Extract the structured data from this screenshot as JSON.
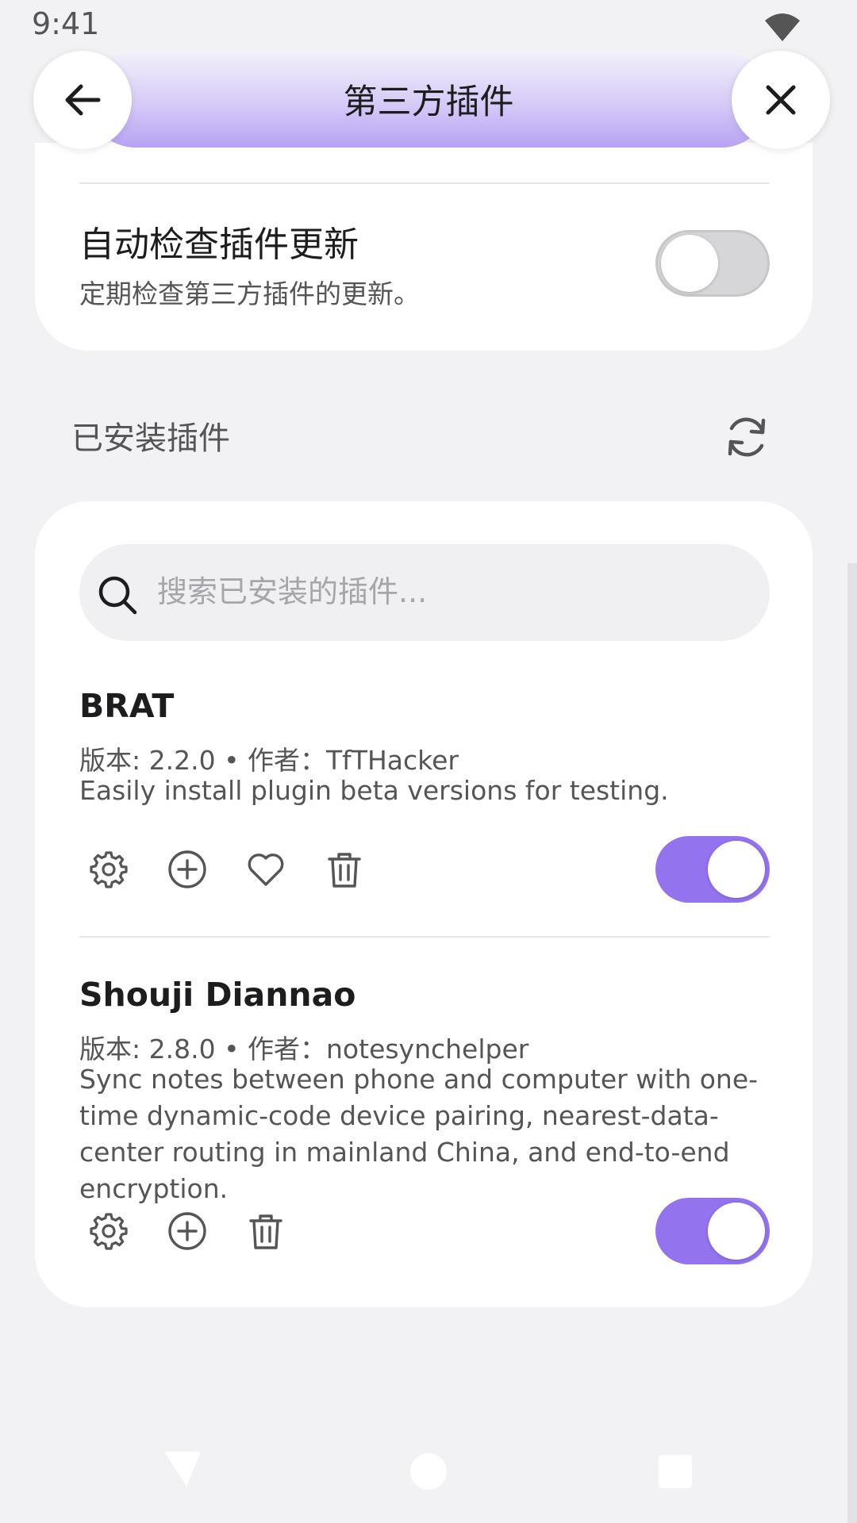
{
  "status_bar": {
    "time": "9:41"
  },
  "header": {
    "title": "第三方插件"
  },
  "auto_update": {
    "title": "自动检查插件更新",
    "subtitle": "定期检查第三方插件的更新。",
    "enabled": false
  },
  "installed": {
    "section_label": "已安装插件",
    "search_placeholder": "搜索已安装的插件...",
    "plugins": [
      {
        "name": "BRAT",
        "meta": "版本: 2.2.0 • 作者：TfTHacker",
        "description": "Easily install plugin beta versions for testing.",
        "enabled": true,
        "actions": [
          "gear-icon",
          "plus-circle-icon",
          "heart-icon",
          "trash-icon"
        ]
      },
      {
        "name": "Shouji Diannao",
        "meta": "版本: 2.8.0 • 作者：notesynchelper",
        "description": "Sync notes between phone and computer with one-time dynamic-code device pairing, nearest-data-center routing in mainland China, and end-to-end encryption.",
        "enabled": true,
        "actions": [
          "gear-icon",
          "plus-circle-icon",
          "trash-icon"
        ]
      }
    ]
  },
  "colors": {
    "accent": "#9373ee",
    "background": "#f2f2f4",
    "card": "#ffffff"
  }
}
